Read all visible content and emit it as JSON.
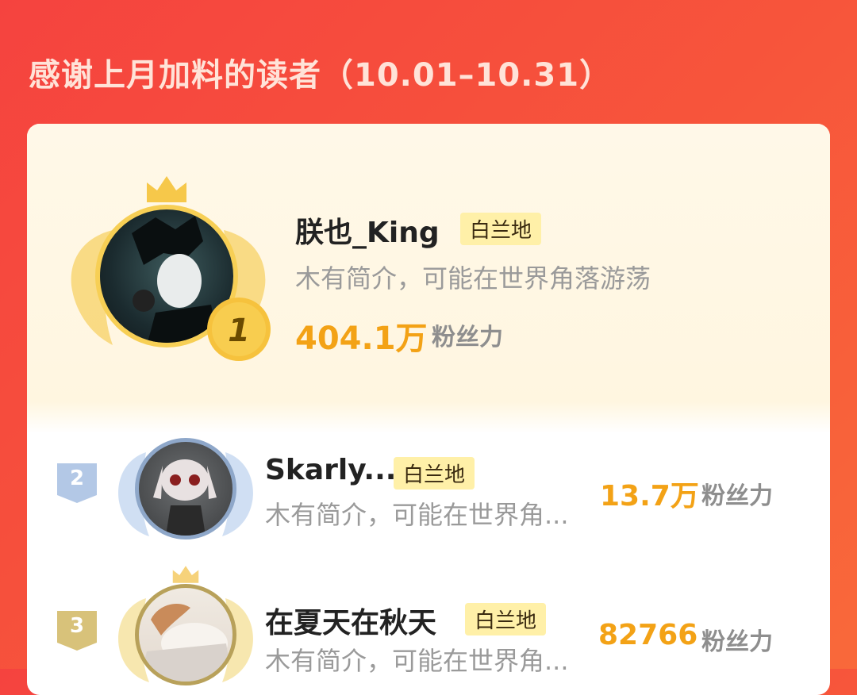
{
  "title": "感谢上月加料的读者（10.01–10.31）",
  "readers": [
    {
      "rank": "1",
      "name": "朕也_King",
      "badge": "白兰地",
      "intro": "木有简介，可能在世界角落游荡",
      "count": "404.1万",
      "unit": "粉丝力"
    },
    {
      "rank": "2",
      "name": "Skarly...",
      "badge": "白兰地",
      "intro": "木有简介，可能在世界角...",
      "count": "13.7万",
      "unit": "粉丝力"
    },
    {
      "rank": "3",
      "name": "在夏天在秋天",
      "badge": "白兰地",
      "intro": "木有简介，可能在世界角...",
      "count": "82766",
      "unit": "粉丝力"
    }
  ],
  "colors": {
    "background": "#f5433f",
    "accent_gold": "#f3a216",
    "badge_bg": "#fff0a8",
    "rank2_silver": "#a9bfe0",
    "rank3_bronze": "#d8c27a"
  },
  "icons": [
    "crown-icon",
    "wings-icon",
    "rank-medal-icon",
    "avatar"
  ]
}
